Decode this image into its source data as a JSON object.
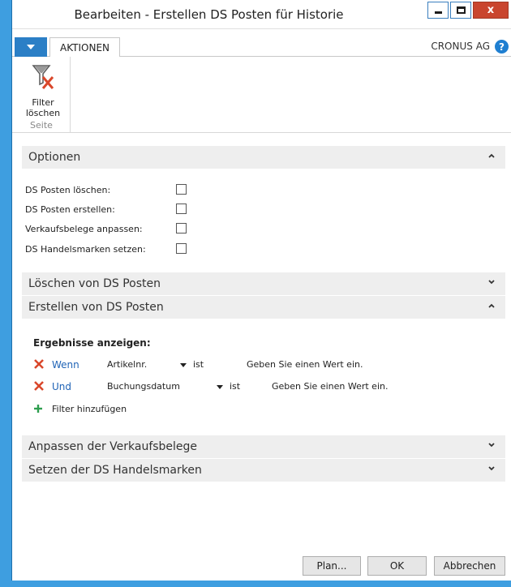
{
  "window": {
    "title": "Bearbeiten - Erstellen DS Posten für Historie",
    "close_glyph": "x"
  },
  "ribbon": {
    "tab_label": "AKTIONEN",
    "company": "CRONUS AG",
    "help_glyph": "?",
    "filter_button_line1": "Filter",
    "filter_button_line2": "löschen",
    "group_label": "Seite"
  },
  "sections": {
    "options": {
      "label": "Optionen",
      "fields": [
        {
          "label": "DS Posten löschen:",
          "checked": false
        },
        {
          "label": "DS Posten erstellen:",
          "checked": false
        },
        {
          "label": "Verkaufsbelege anpassen:",
          "checked": false
        },
        {
          "label": "DS Handelsmarken setzen:",
          "checked": false
        }
      ]
    },
    "delete_entries": {
      "label": "Löschen von DS Posten"
    },
    "create_entries": {
      "label": "Erstellen von DS Posten",
      "results_title": "Ergebnisse anzeigen:",
      "filters": [
        {
          "operator": "Wenn",
          "field": "Artikelnr.",
          "relation": "ist",
          "value_hint": "Geben Sie einen Wert ein."
        },
        {
          "operator": "Und",
          "field": "Buchungsdatum",
          "relation": "ist",
          "value_hint": "Geben Sie einen Wert ein."
        }
      ],
      "add_filter_label": "Filter hinzufügen"
    },
    "adjust_sales_docs": {
      "label": "Anpassen der Verkaufsbelege"
    },
    "set_brands": {
      "label": "Setzen der DS Handelsmarken"
    }
  },
  "footer": {
    "plan_label": "Plan...",
    "ok_label": "OK",
    "cancel_label": "Abbrechen"
  },
  "colors": {
    "accent": "#2b7fc6",
    "link": "#1f63b6",
    "remove_icon": "#d9472b",
    "add_icon": "#2e9e4f",
    "window_border": "#3e9ee0"
  }
}
